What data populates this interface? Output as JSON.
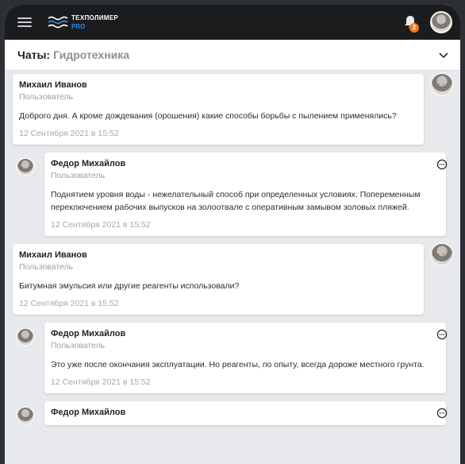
{
  "brand": {
    "name": "ТЕХПОЛИМЕР",
    "sub": "PRO"
  },
  "notifications": {
    "count": "2"
  },
  "chat": {
    "label": "Чаты:",
    "name": "Гидротехника"
  },
  "messages": [
    {
      "author": "Михаил Иванов",
      "role": "Пользователь",
      "text": "Доброго дня. А кроме дождевания (орошения) какие способы борьбы с пылением применялись?",
      "date": "12 Сентября 2021 в 15:52",
      "own": true
    },
    {
      "author": "Федор Михайлов",
      "role": "Пользователь",
      "text": "Поднятием уровня воды - нежелательный способ при определенных условиях. Попеременным переключением рабочих выпусков на золоотвале с оперативным замывом золовых пляжей.",
      "date": "12 Сентября 2021 в 15:52",
      "own": false
    },
    {
      "author": "Михаил Иванов",
      "role": "Пользователь",
      "text": "Битумная эмульсия или другие реагенты использовали?",
      "date": "12 Сентября 2021 в 15:52",
      "own": true
    },
    {
      "author": "Федор Михайлов",
      "role": "Пользователь",
      "text": "Это уже после окончания эксплуатации. Но реагенты, по опыту, всегда дороже местного грунта.",
      "date": "12 Сентября 2021 в 15:52",
      "own": false
    },
    {
      "author": "Федор Михайлов",
      "role": "",
      "text": "",
      "date": "",
      "own": false
    }
  ],
  "colors": {
    "topbar": "#1b1c1e",
    "accent": "#2f8fe6",
    "badge": "#f07a1a",
    "background": "#e7e9ec"
  },
  "icons": {
    "menu": "menu-icon",
    "bell": "bell-icon",
    "chevron": "chevron-down-icon",
    "more": "more-dots-icon",
    "reply": "chat-bubble-icon"
  }
}
